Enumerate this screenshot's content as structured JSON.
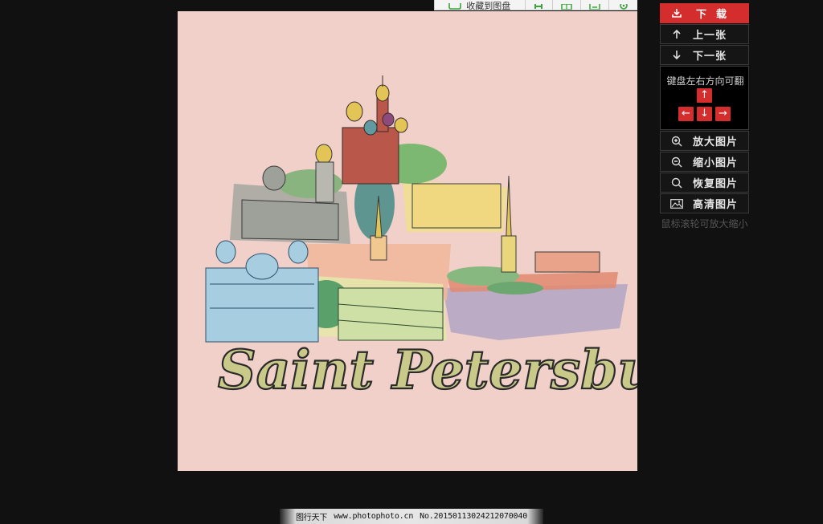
{
  "toolbar": {
    "collect_label": "收藏到图盘"
  },
  "artwork": {
    "title_text": "Saint Petersburg"
  },
  "panel": {
    "download_label": "下载",
    "prev_label": "上一张",
    "next_label": "下一张",
    "keyboard_hint": "键盘左右方向可翻",
    "key_up": "↑",
    "key_left": "←",
    "key_down": "↓",
    "key_right": "→",
    "zoom_in_label": "放大图片",
    "zoom_out_label": "缩小图片",
    "restore_label": "恢复图片",
    "hd_label": "高清图片",
    "wheel_hint": "鼠标滚轮可放大缩小"
  },
  "footer": {
    "site_name": "图行天下",
    "site_url": "www.photophoto.cn",
    "image_no": "No.20150113024212070040"
  },
  "colors": {
    "accent": "#d42d2d",
    "background": "#111111",
    "picture_bg": "#f0d0c8",
    "title_fill": "#c9c98a"
  }
}
